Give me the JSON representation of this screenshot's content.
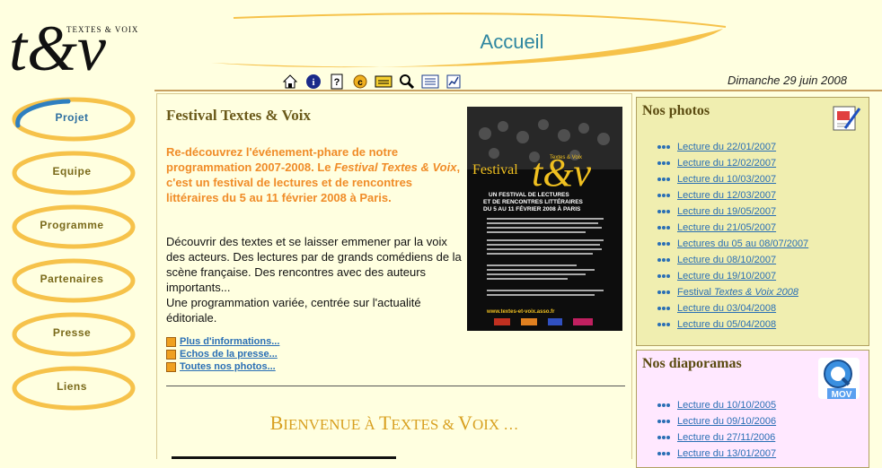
{
  "header": {
    "logo_text": "t&v",
    "logo_subtitle": "TEXTES & VOIX",
    "page_title": "Accueil",
    "date": "Dimanche 29 juin 2008",
    "toolbar_icons": [
      "home-icon",
      "info-icon",
      "help-icon",
      "copyright-icon",
      "mail-icon",
      "search-icon",
      "list-icon",
      "stats-icon"
    ]
  },
  "nav": {
    "items": [
      {
        "label": "Projet",
        "active": true
      },
      {
        "label": "Equipe"
      },
      {
        "label": "Programme"
      },
      {
        "label": "Partenaires"
      },
      {
        "label": "Presse"
      },
      {
        "label": "Liens"
      }
    ]
  },
  "main": {
    "title": "Festival Textes & Voix",
    "lead_part1": "Re-découvrez l'événement-phare de notre programmation 2007-2008. Le ",
    "lead_italic": "Festival Textes & Voix",
    "lead_part2": ", c'est  un festival de lectures et de rencontres littéraires du 5 au 11 février 2008 à Paris.",
    "body_p1": "Découvrir des textes et se laisser emmener par la voix des acteurs. Des lectures par de grands comédiens de la scène française. Des rencontres avec des auteurs importants...",
    "body_p2": "Une programmation variée, centrée sur l'actualité éditoriale.",
    "links": [
      "Plus d'informations...",
      "Echos de la presse...",
      "Toutes nos photos..."
    ],
    "welcome_first": "B",
    "welcome_rest1": "IENVENUE À ",
    "welcome_t": "T",
    "welcome_rest2": "EXTES & ",
    "welcome_v": "V",
    "welcome_rest3": "OIX …",
    "poster": {
      "word": "Festival",
      "logo": "t&v",
      "brand": "Textes & Voix",
      "heading1": "UN FESTIVAL DE LECTURES",
      "heading2": "ET DE RENCONTRES LITTÉRAIRES",
      "heading3": "DU 5 AU 11 FÉVRIER 2008 À PARIS",
      "url": "www.textes-et-voix.asso.fr"
    }
  },
  "photos": {
    "title": "Nos photos",
    "items": [
      {
        "text": "Lecture du 22/01/2007"
      },
      {
        "text": "Lecture du 12/02/2007"
      },
      {
        "text": "Lecture du 10/03/2007"
      },
      {
        "text": "Lecture du 12/03/2007"
      },
      {
        "text": "Lecture du 19/05/2007"
      },
      {
        "text": "Lecture du 21/05/2007"
      },
      {
        "text": "Lectures du 05 au 08/07/2007"
      },
      {
        "text": "Lecture du 08/10/2007"
      },
      {
        "text": "Lecture du 19/10/2007"
      },
      {
        "text": "Festival ",
        "italic": "Textes & Voix 2008"
      },
      {
        "text": "Lecture du 03/04/2008"
      },
      {
        "text": "Lecture du 05/04/2008"
      }
    ]
  },
  "diaporamas": {
    "title": "Nos diaporamas",
    "badge": "MOV",
    "items": [
      {
        "text": "Lecture du 10/10/2005"
      },
      {
        "text": "Lecture du 09/10/2006"
      },
      {
        "text": "Lecture du 27/11/2006"
      },
      {
        "text": "Lecture du 13/01/2007"
      }
    ]
  },
  "colors": {
    "background": "#ffffe0",
    "accent_orange": "#f08c28",
    "link_blue": "#2a6fb5",
    "title_teal": "#2e86a0"
  }
}
